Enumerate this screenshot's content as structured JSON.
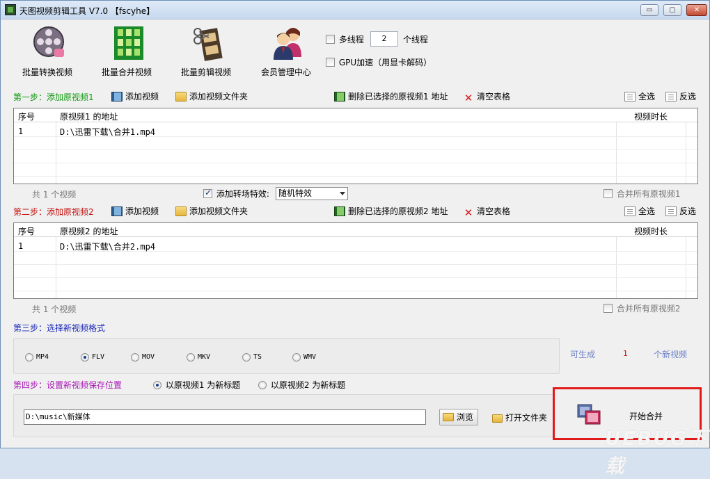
{
  "window": {
    "title": "天图视频剪辑工具 V7.0 【fscyhe】",
    "controls": {
      "minimize": "▭",
      "maximize": "▢",
      "close": "✕"
    }
  },
  "toolbar": {
    "batch_convert": "批量转换视频",
    "batch_merge": "批量合并视频",
    "batch_cut": "批量剪辑视频",
    "member": "会员管理中心",
    "multithread_label": "多线程",
    "threads_value": "2",
    "threads_unit": "个线程",
    "gpu_label": "GPU加速（用显卡解码）"
  },
  "step1": {
    "title": "第一步：添加原视频1",
    "add_video": "添加视频",
    "add_folder": "添加视频文件夹",
    "delete_selected": "删除已选择的原视频1 地址",
    "clear_table": "清空表格",
    "select_all": "全选",
    "invert": "反选",
    "columns": {
      "index": "序号",
      "path": "原视频1 的地址",
      "duration": "视频时长"
    },
    "rows": [
      {
        "index": "1",
        "path": "D:\\迅雷下载\\合并1.mp4",
        "duration": ""
      }
    ],
    "count": "共 1 个视频",
    "transition_label": "添加转场特效:",
    "transition_value": "随机特效",
    "merge_all": "合并所有原视频1"
  },
  "step2": {
    "title": "第二步：添加原视频2",
    "add_video": "添加视频",
    "add_folder": "添加视频文件夹",
    "delete_selected": "删除已选择的原视频2 地址",
    "clear_table": "清空表格",
    "select_all": "全选",
    "invert": "反选",
    "columns": {
      "index": "序号",
      "path": "原视频2 的地址",
      "duration": "视频时长"
    },
    "rows": [
      {
        "index": "1",
        "path": "D:\\迅雷下载\\合并2.mp4",
        "duration": ""
      }
    ],
    "count": "共 1 个视频",
    "merge_all": "合并所有原视频2"
  },
  "step3": {
    "title": "第三步：选择新视频格式",
    "formats": [
      "MP4",
      "FLV",
      "MOV",
      "MKV",
      "TS",
      "WMV"
    ],
    "selected_format": "FLV",
    "can_generate": "可生成",
    "generate_count": "1",
    "generate_unit": "个新视频"
  },
  "step4": {
    "title": "第四步：设置新视频保存位置",
    "opt1": "以原视频1 为新标题",
    "opt2": "以原视频2 为新标题",
    "selected_opt": "opt1",
    "path_value": "D:\\music\\新媒体",
    "browse": "浏览",
    "open_folder": "打开文件夹",
    "start_merge": "开始合并"
  },
  "watermark": "UEBUG下载",
  "colors": {
    "step_green": "#119a0e",
    "step_red": "#c4110f",
    "step_blue": "#1a28b8",
    "step_purple": "#a818b4",
    "highlight_border": "#e01919",
    "count_red": "#c4110f",
    "label_blue": "#6a7fc4"
  }
}
